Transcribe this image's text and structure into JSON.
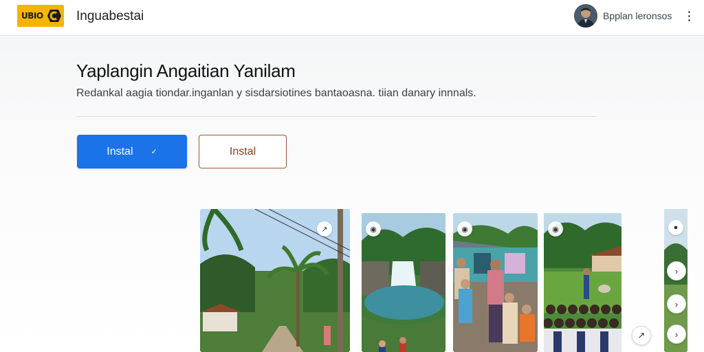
{
  "header": {
    "logo_text": "UBIO",
    "app_name": "Inguabestai",
    "user_name": "Bpplan leronsos",
    "more_icon": "more-vert-icon"
  },
  "main": {
    "headline": "Yaplangin Angaitian Yanilam",
    "subline": "Redankal aagia tiondar.inganlan y sisdarsiotines bantaoasna. tiian danary innnals.",
    "primary_button": {
      "label": "Instal",
      "icon": "check-icon"
    },
    "secondary_button": {
      "label": "Instal"
    }
  },
  "gallery": {
    "cards": [
      {
        "scene": "village-road-palms",
        "badge_icon": "expand-icon",
        "badge_glyph": "↗"
      },
      {
        "scene": "waterfall",
        "badge_icon": "record-icon",
        "badge_glyph": "◉"
      },
      {
        "scene": "villagers-house",
        "badge_icon": "record-icon",
        "badge_glyph": "◉"
      },
      {
        "scene": "crowd-field",
        "badge_icon": "record-icon",
        "badge_glyph": "◉"
      },
      {
        "scene": "partial-card",
        "badge_icon": "record-icon",
        "badge_glyph": "●"
      }
    ],
    "controls": {
      "expand_glyph": "↗",
      "next_glyph": "›"
    }
  },
  "colors": {
    "accent": "#1a73e8",
    "secondary_border": "#a0522d",
    "logo_bg": "#f4b400"
  }
}
